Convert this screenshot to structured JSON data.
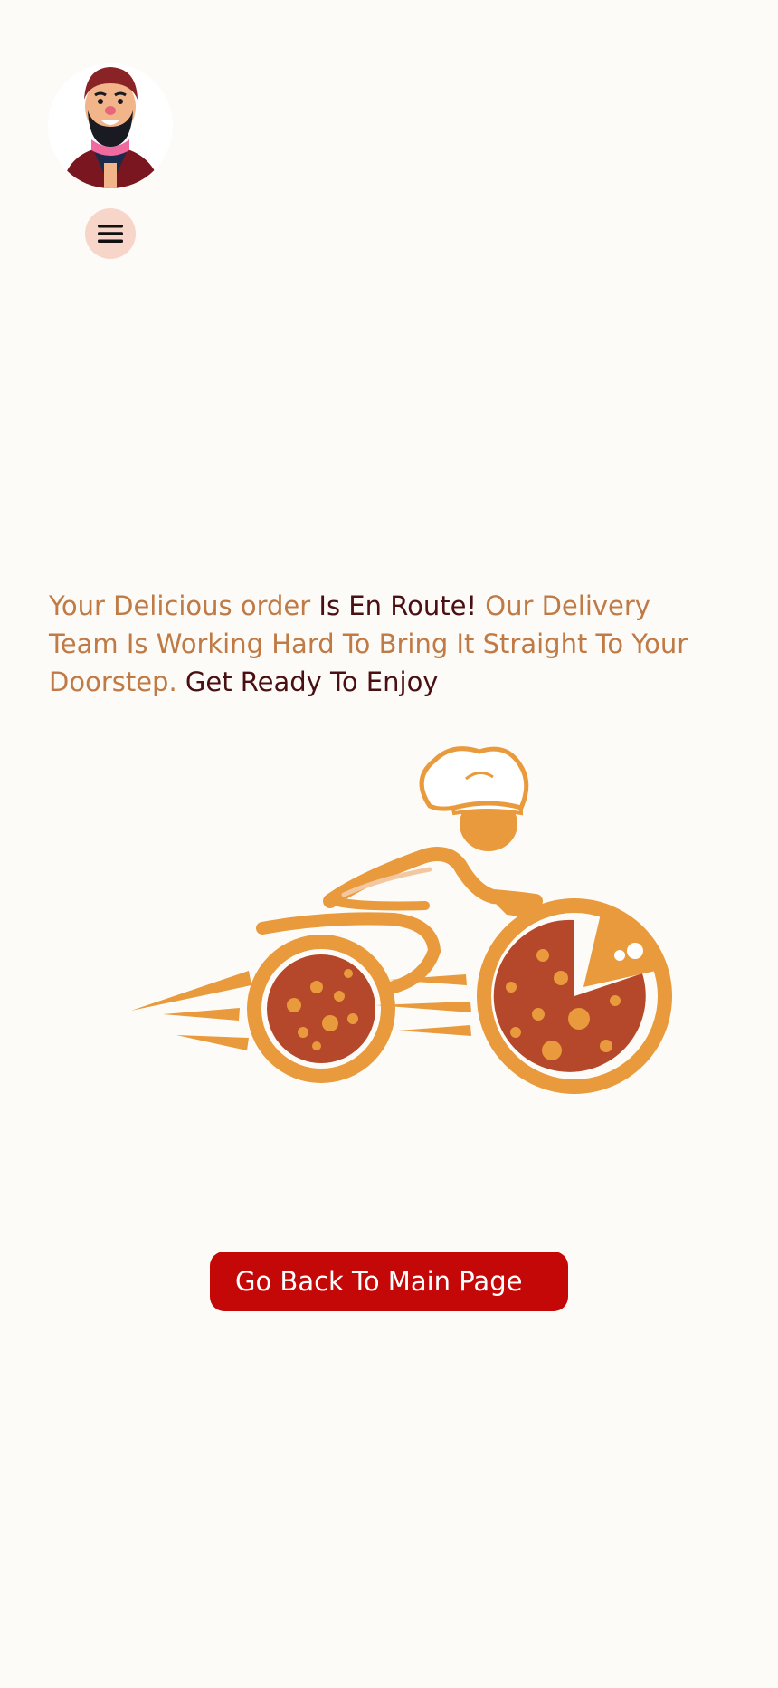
{
  "header": {
    "avatar_icon": "chef-avatar-icon",
    "menu_icon": "hamburger-menu-icon"
  },
  "message": {
    "part1": "Your Delicious order ",
    "part2": " Is En Route!",
    "part3": " Our Delivery Team Is Working Hard To Bring It Straight To Your Doorstep.",
    "part4": " Get Ready To Enjoy"
  },
  "illustration": {
    "icon": "pizza-delivery-rider-icon"
  },
  "actions": {
    "back_label": "Go Back To Main Page"
  },
  "colors": {
    "background": "#fdfbf7",
    "accent_text": "#c07a45",
    "dark_text": "#4a0f12",
    "button": "#c40808",
    "menu_bg": "#f7d5c8",
    "orange": "#e89a3c",
    "pizza_red": "#b5472a"
  }
}
